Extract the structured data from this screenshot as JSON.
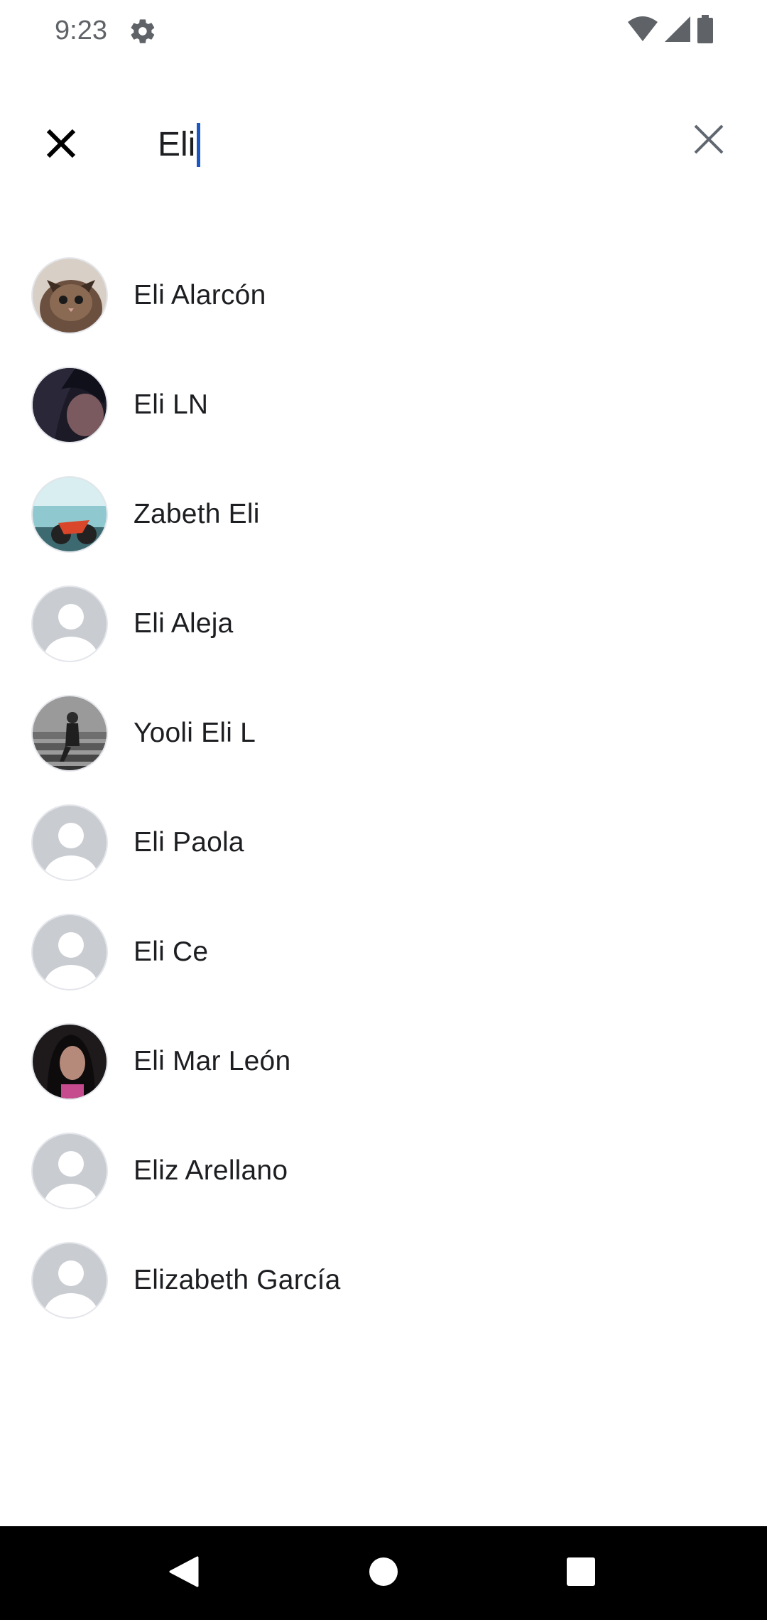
{
  "status_bar": {
    "time": "9:23",
    "icons": [
      "settings-icon",
      "wifi-icon",
      "cellular-signal-icon",
      "battery-icon"
    ]
  },
  "search": {
    "value": "Eli",
    "close_icon": "close-icon",
    "clear_icon": "clear-icon"
  },
  "results": [
    {
      "name": "Eli Alarcón",
      "avatar": "photo-cat"
    },
    {
      "name": "Eli LN",
      "avatar": "photo-dark"
    },
    {
      "name": "Zabeth Eli",
      "avatar": "photo-motorcycle"
    },
    {
      "name": "Eli Aleja",
      "avatar": "default-person"
    },
    {
      "name": "Yooli Eli L",
      "avatar": "photo-stairs"
    },
    {
      "name": "Eli Paola",
      "avatar": "default-person"
    },
    {
      "name": "Eli Ce",
      "avatar": "default-person"
    },
    {
      "name": "Eli Mar León",
      "avatar": "photo-portrait"
    },
    {
      "name": "Eliz Arellano",
      "avatar": "default-person"
    },
    {
      "name": "Elizabeth García",
      "avatar": "default-person"
    }
  ],
  "nav_bar": {
    "icons": [
      "back-icon",
      "home-icon",
      "recents-icon"
    ]
  },
  "colors": {
    "caret": "#1a56c4",
    "default_avatar_bg": "#c9ccd1",
    "nav_bar_bg": "#000000"
  }
}
